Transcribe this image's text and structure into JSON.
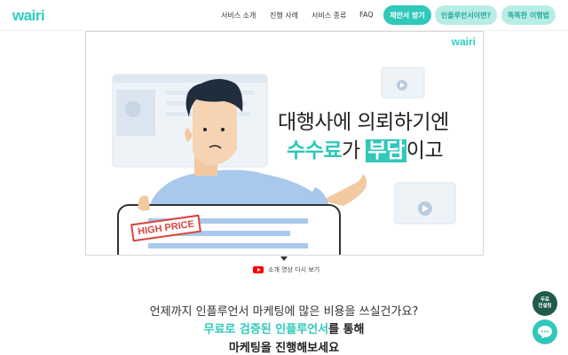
{
  "header": {
    "logo": "wairi",
    "nav": [
      "서비스 소개",
      "진행 사례",
      "서비스 종류",
      "FAQ"
    ],
    "cta_primary": "제안서 받기",
    "cta_influencer": "인플루언서이면?",
    "cta_usage": "똑똑한 이행법"
  },
  "video": {
    "logo": "wairi",
    "line1": "대행사에 의뢰하기엔",
    "line2_teal": "수수료",
    "line2_mid": "가 ",
    "line2_box": "부담",
    "line2_end": "이고",
    "stamp": "HIGH PRICE",
    "caption": "소개 영상 다시 보기"
  },
  "intro": {
    "line1": "언제까지 인플루언서 마케팅에 많은 비용을 쓰실건가요?",
    "line2_teal": "무료로 검증된 인플루언서",
    "line2_end": "를 통해",
    "line3": "마케팅을 진행해보세요"
  },
  "float": {
    "consult_line1": "무료",
    "consult_line2": "컨설팅",
    "chat_icon": "chat-icon"
  },
  "colors": {
    "accent": "#2fc8b9",
    "accent_light": "#b8ede6"
  }
}
